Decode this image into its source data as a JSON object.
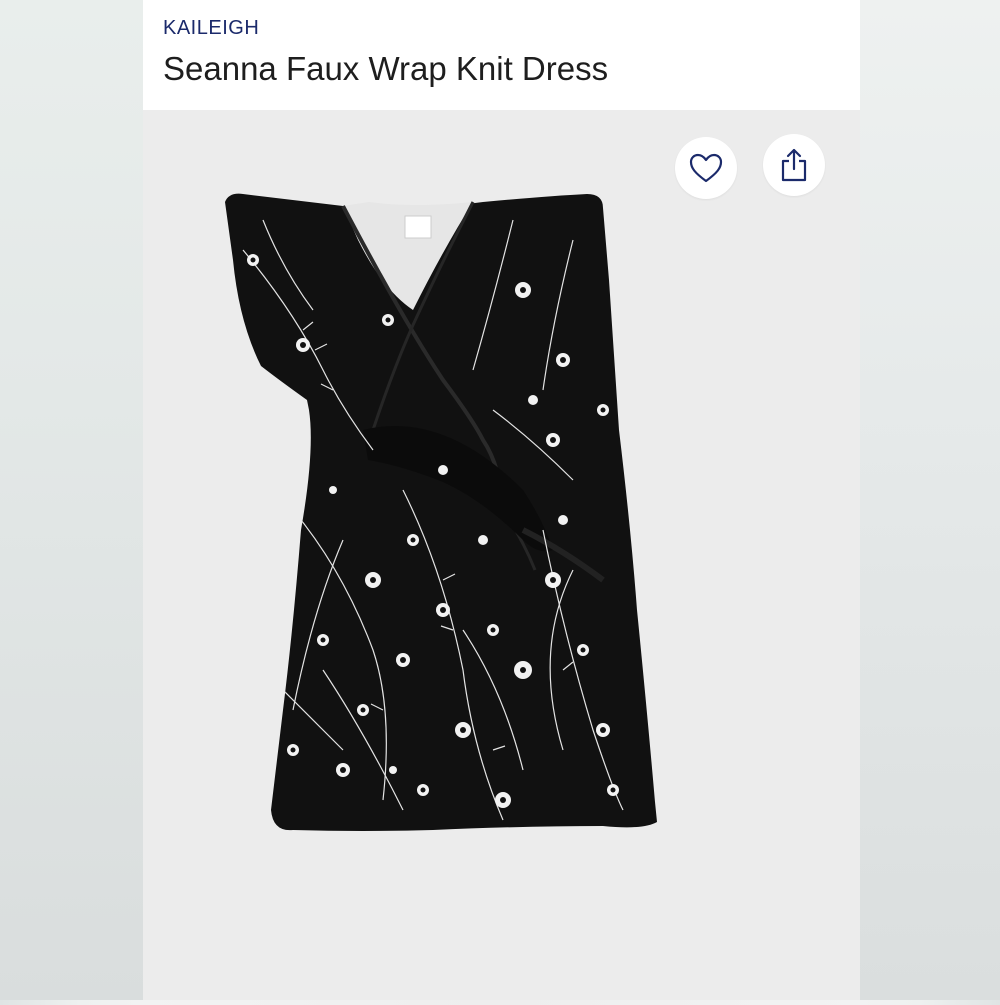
{
  "product": {
    "brand": "KAILEIGH",
    "name": "Seanna Faux Wrap Knit Dress"
  },
  "actions": {
    "favorite_icon": "heart-outline-icon",
    "share_icon": "share-upload-icon"
  },
  "colors": {
    "brand_text": "#1b2a6b",
    "title_text": "#1e1e1e",
    "dress_base": "#111111",
    "print": "#f2f2f2"
  }
}
